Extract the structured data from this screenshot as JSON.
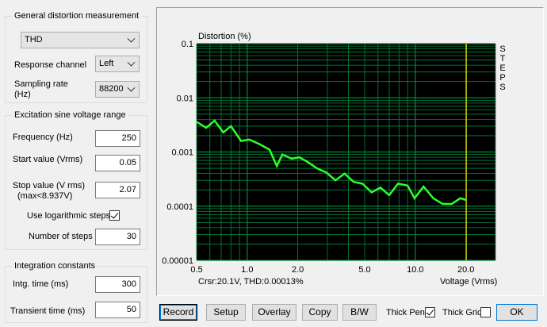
{
  "general": {
    "title": "General distortion measurement",
    "measurement_type": "THD",
    "response_channel_label": "Response channel",
    "response_channel": "Left",
    "sampling_rate_label": "Sampling rate (Hz)",
    "sampling_rate": "88200"
  },
  "excitation": {
    "title": "Excitation sine voltage range",
    "frequency_label": "Frequency (Hz)",
    "frequency": "250",
    "start_label": "Start value (Vrms)",
    "start": "0.05",
    "stop_label": "Stop value (V rms)",
    "stop_sub": "(max<8.937V)",
    "stop": "2.07",
    "log_steps_label": "Use logarithmic steps",
    "log_steps": true,
    "num_steps_label": "Number of steps",
    "num_steps": "30"
  },
  "integration": {
    "title": "Integration constants",
    "intg_time_label": "Intg. time (ms)",
    "intg_time": "300",
    "transient_label": "Transient time (ms)",
    "transient": "50"
  },
  "buttons": {
    "record": "Record",
    "setup": "Setup",
    "overlay": "Overlay",
    "copy": "Copy",
    "bw": "B/W",
    "thick_pen": "Thick Pen",
    "thick_grid": "Thick Grid",
    "ok": "OK"
  },
  "toggles": {
    "thick_pen": true,
    "thick_grid": false
  },
  "colors": {
    "plot_bg": "#000000",
    "grid": "#008a3c",
    "trace": "#2cff2c",
    "cursor": "#c8c800"
  },
  "chart_data": {
    "type": "line",
    "title": "Distortion (%)",
    "xlabel": "Voltage (Vrms)",
    "x_scale": "log",
    "y_scale": "log",
    "xlim": [
      0.5,
      30
    ],
    "ylim": [
      1e-05,
      0.1
    ],
    "x_ticks": [
      "0.5",
      "1.0",
      "2.0",
      "5.0",
      "10.0",
      "20.0"
    ],
    "y_ticks": [
      "0.1",
      "0.01",
      "0.001",
      "0.0001",
      "0.00001"
    ],
    "side_label": "STEPS",
    "cursor_x": 20.1,
    "cursor_text": "Crsr:20.1V, THD:0.00013%",
    "grid": true,
    "series": [
      {
        "x": [
          0.5,
          0.57,
          0.64,
          0.72,
          0.8,
          0.92,
          1.03,
          1.18,
          1.36,
          1.5,
          1.62,
          1.84,
          2.04,
          2.3,
          2.6,
          2.95,
          3.35,
          3.8,
          4.3,
          4.85,
          5.5,
          6.2,
          7.0,
          7.9,
          9.0,
          9.9,
          11.2,
          12.8,
          14.5,
          16.5,
          18.5,
          20.1
        ],
        "y": [
          0.0036,
          0.0028,
          0.0038,
          0.0023,
          0.003,
          0.0016,
          0.0017,
          0.0014,
          0.0011,
          0.00055,
          0.0009,
          0.00075,
          0.0008,
          0.00065,
          0.0005,
          0.00042,
          0.0003,
          0.0004,
          0.00028,
          0.00026,
          0.00018,
          0.00022,
          0.00016,
          0.00026,
          0.00024,
          0.00014,
          0.00023,
          0.00014,
          0.00011,
          0.00011,
          0.00014,
          0.00013
        ]
      }
    ]
  }
}
